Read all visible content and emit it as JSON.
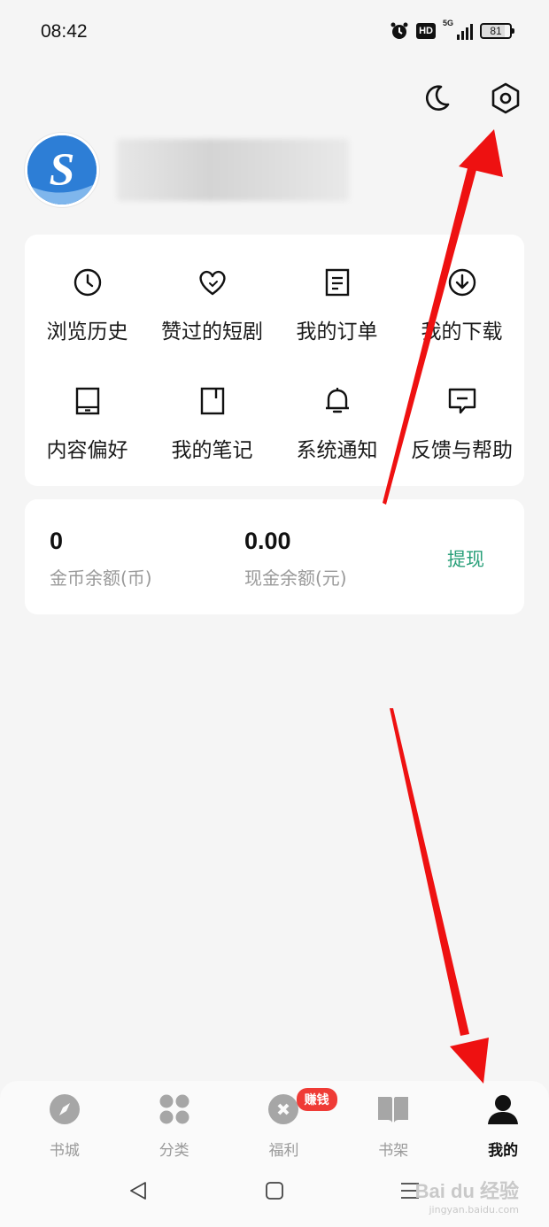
{
  "status_bar": {
    "time": "08:42",
    "hd_label": "HD",
    "network_label": "5G",
    "battery_level": "81"
  },
  "top_actions": {
    "night_mode_icon": "moon-icon",
    "settings_icon": "settings-hexagon-icon"
  },
  "profile": {
    "avatar_letter": "S"
  },
  "menu": {
    "items": [
      {
        "label": "浏览历史",
        "icon": "clock-icon"
      },
      {
        "label": "赞过的短剧",
        "icon": "heart-icon"
      },
      {
        "label": "我的订单",
        "icon": "order-list-icon"
      },
      {
        "label": "我的下载",
        "icon": "download-icon"
      },
      {
        "label": "内容偏好",
        "icon": "tablet-icon"
      },
      {
        "label": "我的笔记",
        "icon": "note-icon"
      },
      {
        "label": "系统通知",
        "icon": "bell-icon"
      },
      {
        "label": "反馈与帮助",
        "icon": "feedback-icon"
      }
    ]
  },
  "wallet": {
    "coins_value": "0",
    "coins_label": "金币余额(币)",
    "cash_value": "0.00",
    "cash_label": "现金余额(元)",
    "withdraw_label": "提现",
    "accent_color": "#2aa07a"
  },
  "tabbar": {
    "tabs": [
      {
        "label": "书城",
        "icon": "compass-icon",
        "active": false
      },
      {
        "label": "分类",
        "icon": "category-icon",
        "active": false
      },
      {
        "label": "福利",
        "icon": "coin-icon",
        "active": false,
        "badge": "赚钱"
      },
      {
        "label": "书架",
        "icon": "book-icon",
        "active": false
      },
      {
        "label": "我的",
        "icon": "person-icon",
        "active": true
      }
    ]
  },
  "watermark": {
    "brand": "Bai du 经验",
    "url": "jingyan.baidu.com"
  },
  "annotation_color": "#ee1111"
}
